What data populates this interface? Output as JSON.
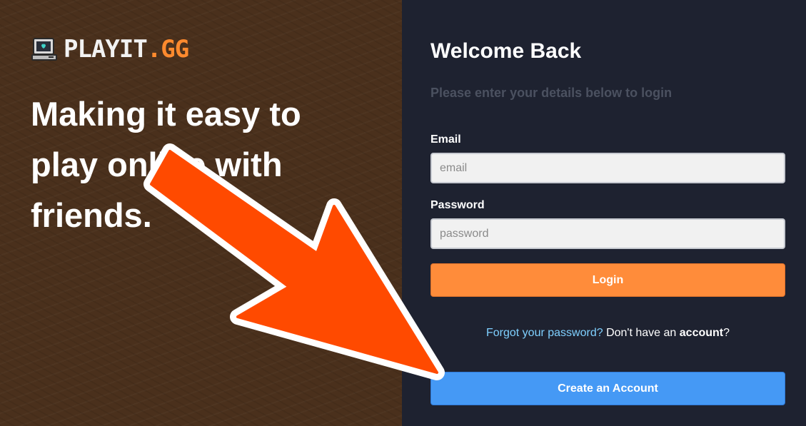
{
  "brand": {
    "logo_main": "PLAYIT",
    "logo_accent": ".GG",
    "logo_icon": "retro-computer-icon"
  },
  "hero": {
    "tagline": "Making it easy to play online with friends."
  },
  "login": {
    "title": "Welcome Back",
    "subtitle": "Please enter your details below to login",
    "email_label": "Email",
    "email_placeholder": "email",
    "email_value": "",
    "password_label": "Password",
    "password_placeholder": "password",
    "password_value": "",
    "login_button": "Login",
    "forgot_link": "Forgot your password?",
    "no_account_prefix": "Don't have an",
    "no_account_bold": "account",
    "no_account_suffix": "?",
    "create_account_button": "Create an Account"
  },
  "annotation": {
    "icon": "arrow-pointer-icon",
    "color": "#ff4a00"
  },
  "colors": {
    "left_bg": "#4a301c",
    "right_bg": "#1e2230",
    "accent_orange": "#ff8c3a",
    "accent_blue": "#4599f5",
    "link_color": "#7fd0ff"
  }
}
